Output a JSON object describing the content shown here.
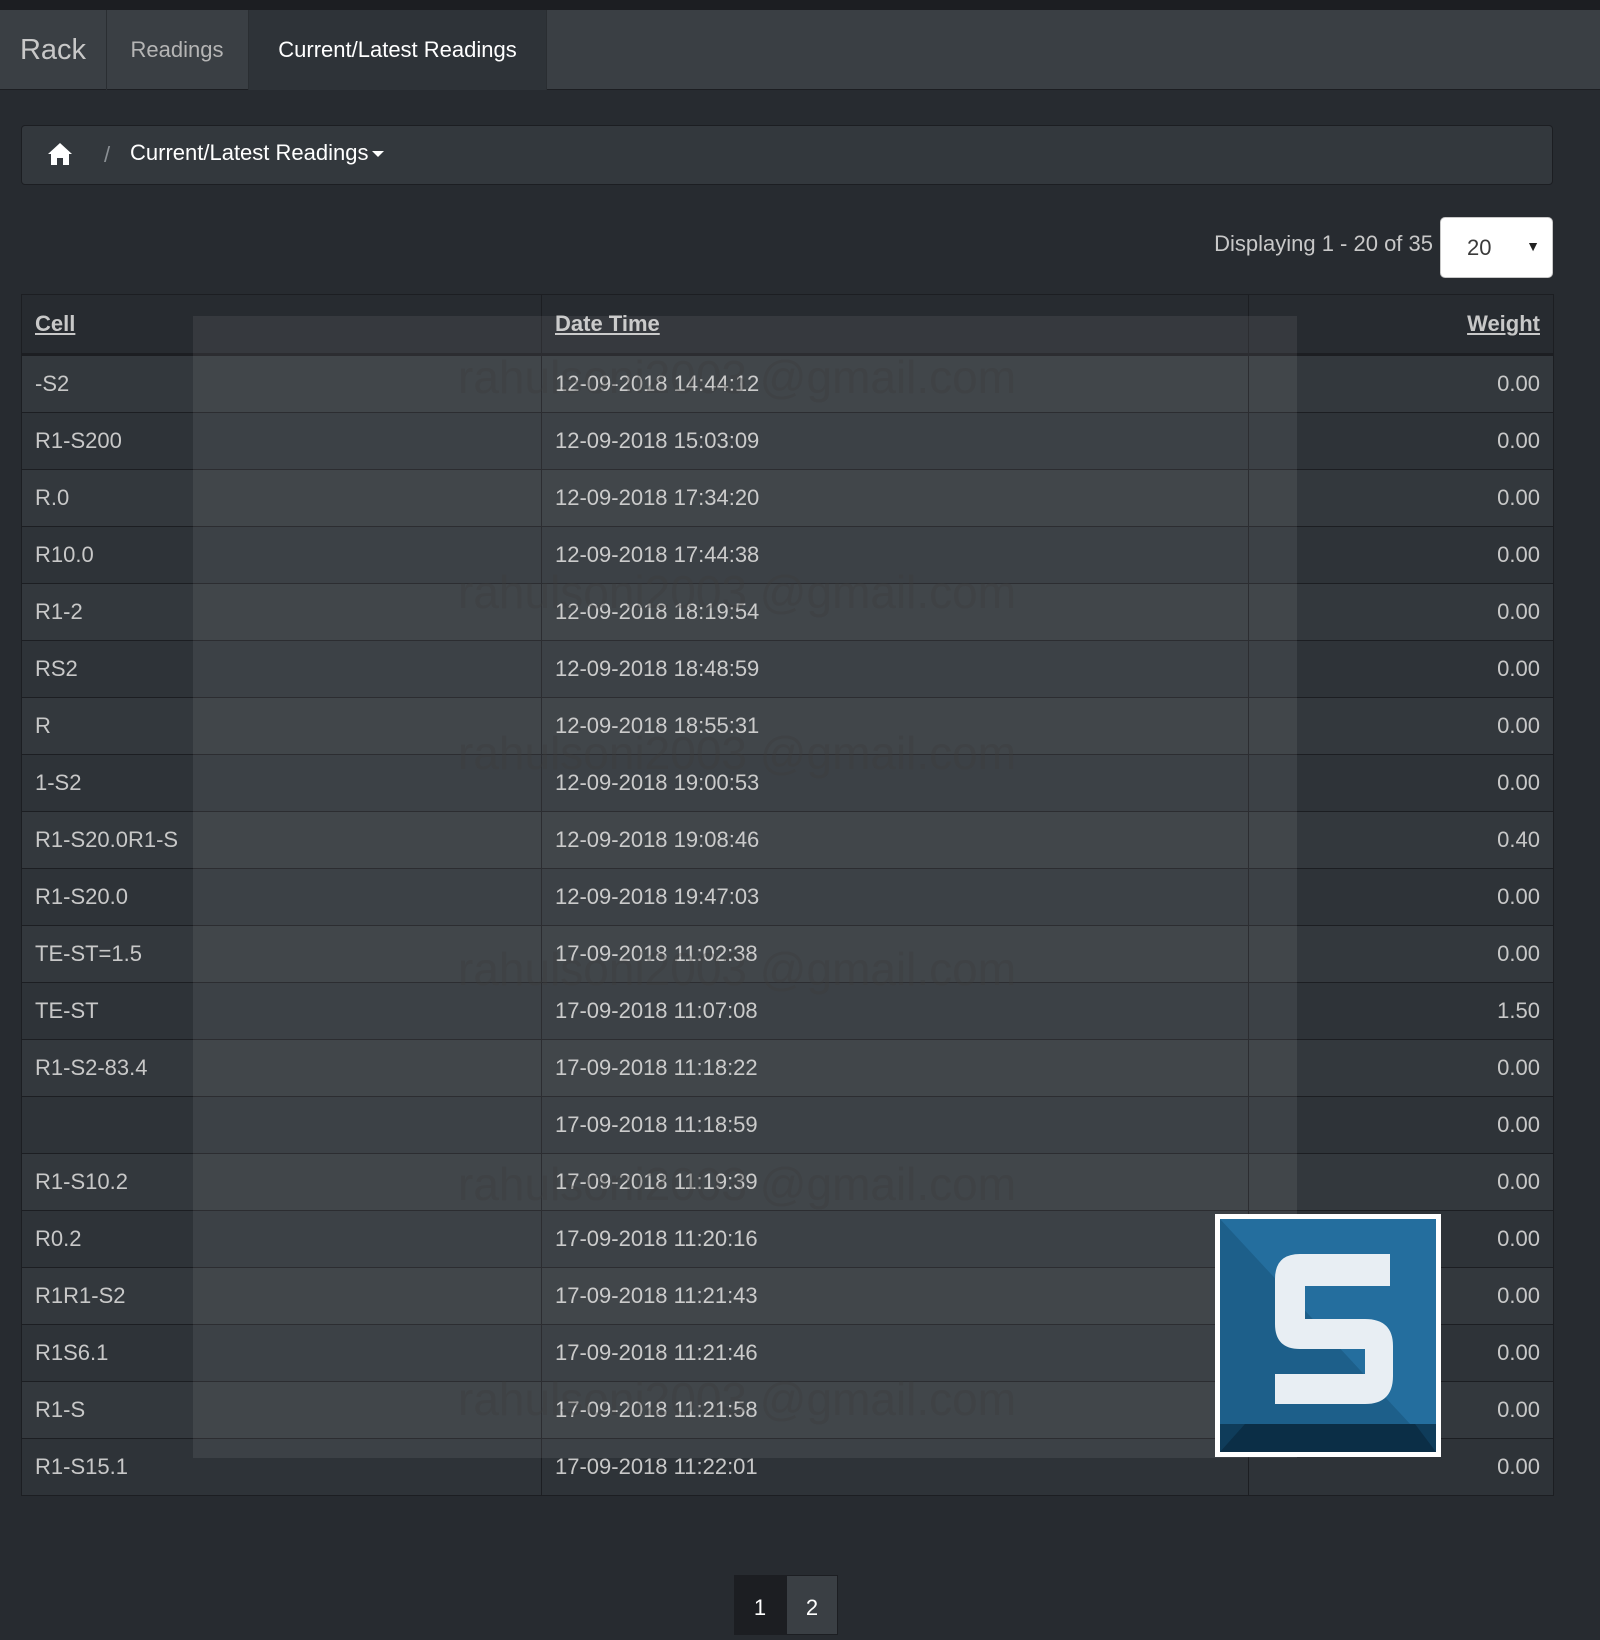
{
  "navbar": {
    "brand": "Rack",
    "links": [
      {
        "label": "Readings"
      },
      {
        "label": "Current/Latest Readings"
      }
    ]
  },
  "breadcrumb": {
    "separator": "/",
    "current": "Current/Latest Readings"
  },
  "pagination_info": {
    "text": "Displaying 1 - 20 of 35",
    "page_size": "20"
  },
  "table": {
    "headers": {
      "cell": "Cell",
      "datetime": "Date Time",
      "weight": "Weight"
    },
    "rows": [
      {
        "cell": "-S2",
        "datetime": "12-09-2018 14:44:12",
        "weight": "0.00"
      },
      {
        "cell": "R1-S200",
        "datetime": "12-09-2018 15:03:09",
        "weight": "0.00"
      },
      {
        "cell": "R.0",
        "datetime": "12-09-2018 17:34:20",
        "weight": "0.00"
      },
      {
        "cell": "R10.0",
        "datetime": "12-09-2018 17:44:38",
        "weight": "0.00"
      },
      {
        "cell": "R1-2",
        "datetime": "12-09-2018 18:19:54",
        "weight": "0.00"
      },
      {
        "cell": "RS2",
        "datetime": "12-09-2018 18:48:59",
        "weight": "0.00"
      },
      {
        "cell": "R",
        "datetime": "12-09-2018 18:55:31",
        "weight": "0.00"
      },
      {
        "cell": "1-S2",
        "datetime": "12-09-2018 19:00:53",
        "weight": "0.00"
      },
      {
        "cell": "R1-S20.0R1-S",
        "datetime": "12-09-2018 19:08:46",
        "weight": "0.40"
      },
      {
        "cell": "R1-S20.0",
        "datetime": "12-09-2018 19:47:03",
        "weight": "0.00"
      },
      {
        "cell": "TE-ST=1.5",
        "datetime": "17-09-2018 11:02:38",
        "weight": "0.00"
      },
      {
        "cell": "TE-ST",
        "datetime": "17-09-2018 11:07:08",
        "weight": "1.50"
      },
      {
        "cell": "R1-S2-83.4",
        "datetime": "17-09-2018 11:18:22",
        "weight": "0.00"
      },
      {
        "cell": "",
        "datetime": "17-09-2018 11:18:59",
        "weight": "0.00"
      },
      {
        "cell": "R1-S10.2",
        "datetime": "17-09-2018 11:19:39",
        "weight": "0.00"
      },
      {
        "cell": "R0.2",
        "datetime": "17-09-2018 11:20:16",
        "weight": "0.00"
      },
      {
        "cell": "R1R1-S2",
        "datetime": "17-09-2018 11:21:43",
        "weight": "0.00"
      },
      {
        "cell": "R1S6.1",
        "datetime": "17-09-2018 11:21:46",
        "weight": "0.00"
      },
      {
        "cell": "R1-S",
        "datetime": "17-09-2018 11:21:58",
        "weight": "0.00"
      },
      {
        "cell": "R1-S15.1",
        "datetime": "17-09-2018 11:22:01",
        "weight": "0.00"
      }
    ]
  },
  "watermark": {
    "text": "rahulsoni2003 @gmail.com"
  },
  "pager": {
    "pages": [
      "1",
      "2"
    ]
  },
  "icons": {
    "home": "home-icon",
    "caret": "caret-down-icon",
    "logo": "snagit-logo-icon"
  },
  "colors": {
    "background": "#272b30",
    "navbar": "#3a3f44",
    "logo_blue": "#1d5f8a"
  }
}
